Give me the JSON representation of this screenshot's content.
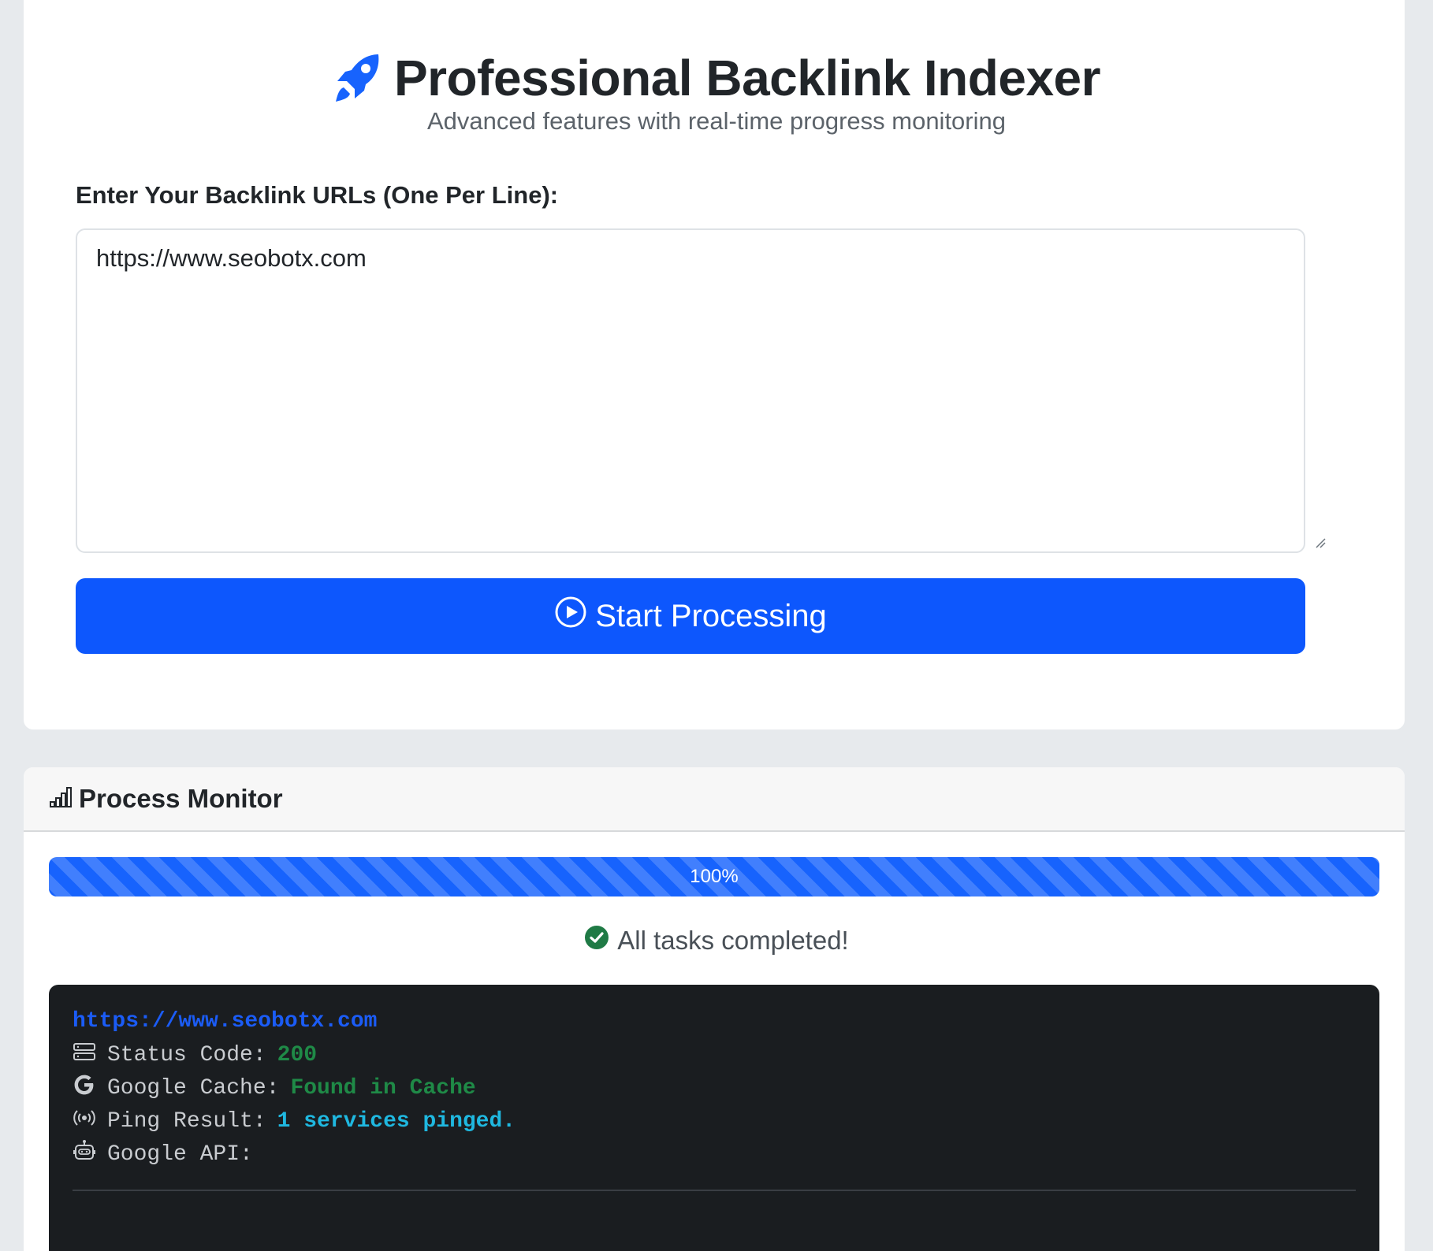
{
  "header": {
    "title": "Professional Backlink Indexer",
    "subtitle": "Advanced features with real-time progress monitoring",
    "icon": "rocket-icon"
  },
  "form": {
    "label": "Enter Your Backlink URLs (One Per Line):",
    "urls_value": "https://www.seobotx.com",
    "start_button_label": "Start Processing",
    "start_button_icon": "play-circle-icon"
  },
  "monitor": {
    "title": "Process Monitor",
    "title_icon": "bar-chart-icon",
    "progress_label": "100%",
    "progress_value": 100,
    "status_text": "All tasks completed!",
    "status_icon": "check-circle-icon"
  },
  "results": {
    "url": "https://www.seobotx.com",
    "status_code_label": "Status Code:",
    "status_code_value": "200",
    "cache_label": "Google Cache:",
    "cache_value": "Found in Cache",
    "ping_label": "Ping Result:",
    "ping_value": "1 services pinged.",
    "api_label": "Google API:",
    "api_value": ""
  },
  "colors": {
    "accent": "#0d57fd",
    "success": "#1f8a47",
    "info": "#1fb8e0",
    "console_bg": "#1a1d20",
    "page_bg": "#e7eaed"
  }
}
